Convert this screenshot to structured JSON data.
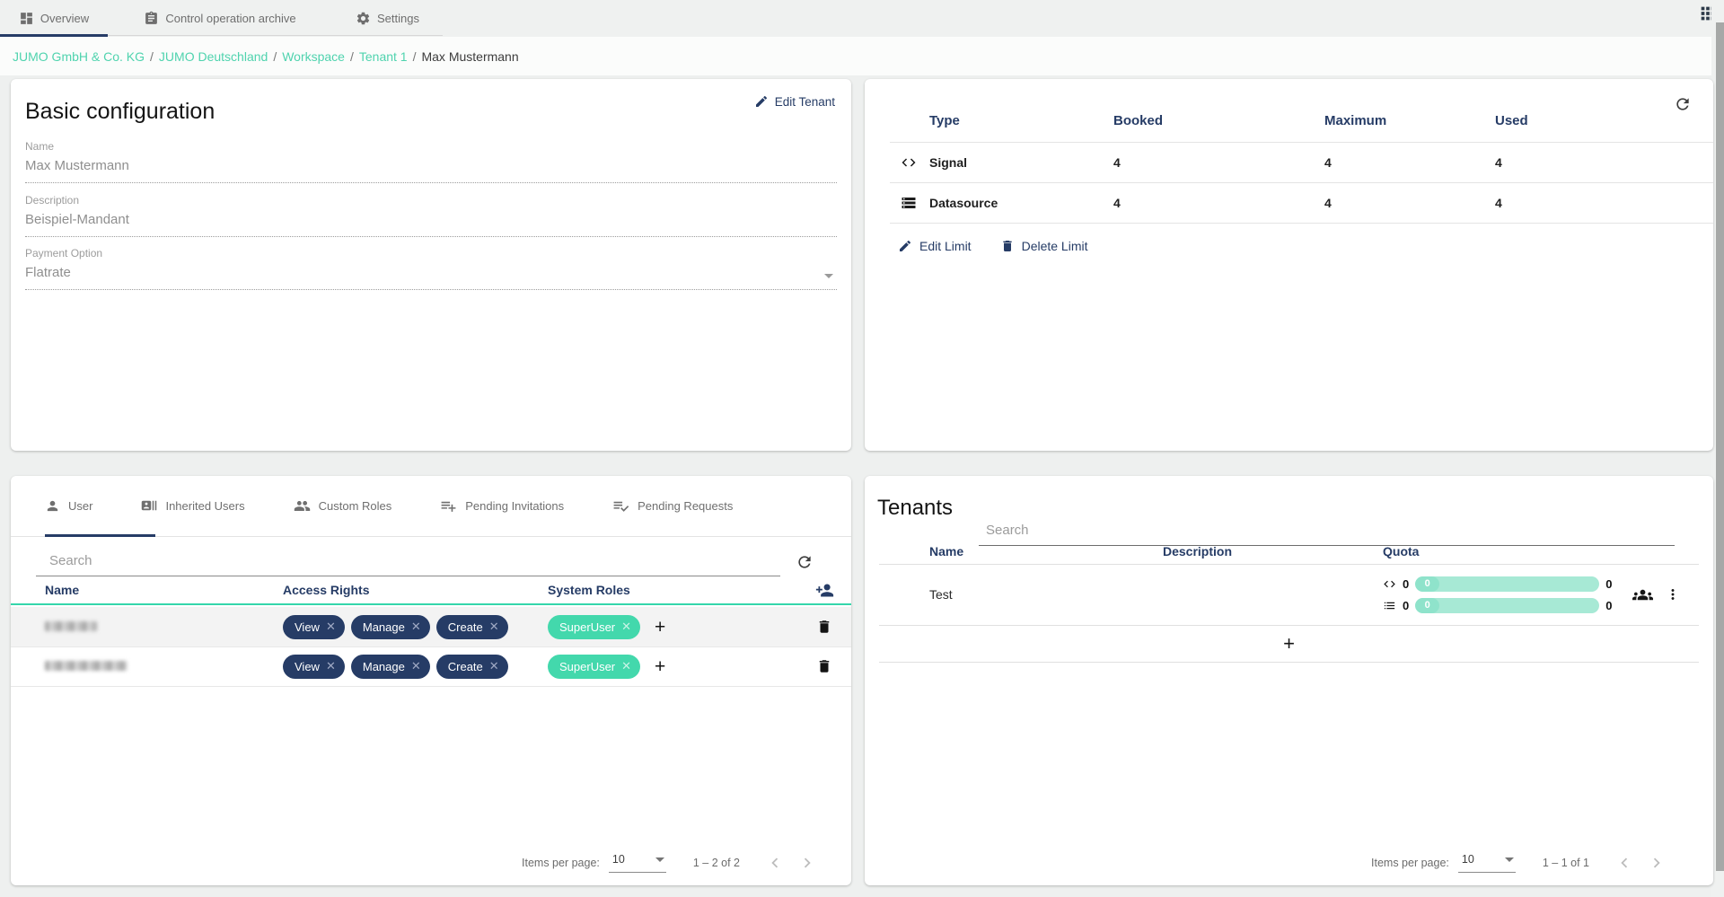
{
  "colors": {
    "navy": "#263c66",
    "teal_link": "#4fd3ae",
    "teal_chip": "#43d8ac",
    "teal_header_line": "#35d6ab",
    "quota_bar": "#a7e9d5",
    "page_bg": "#eef0ef"
  },
  "top_tabs": [
    {
      "label": "Overview",
      "icon": "dashboard-icon",
      "active": true
    },
    {
      "label": "Control operation archive",
      "icon": "clipboard-icon",
      "active": false
    },
    {
      "label": "Settings",
      "icon": "gear-icon",
      "active": false
    }
  ],
  "breadcrumb": {
    "separator": "/",
    "links": [
      "JUMO GmbH & Co. KG",
      "JUMO Deutschland",
      "Workspace",
      "Tenant 1"
    ],
    "current": "Max Mustermann"
  },
  "basic_config": {
    "title": "Basic configuration",
    "edit_button": "Edit Tenant",
    "fields": [
      {
        "label": "Name",
        "value": "Max Mustermann"
      },
      {
        "label": "Description",
        "value": "Beispiel-Mandant"
      },
      {
        "label": "Payment Option",
        "value": "Flatrate",
        "dropdown": true
      }
    ]
  },
  "limits": {
    "headers": [
      "Type",
      "Booked",
      "Maximum",
      "Used"
    ],
    "rows": [
      {
        "label": "Signal",
        "icon": "code-icon",
        "values": [
          "4",
          "4",
          "4"
        ]
      },
      {
        "label": "Datasource",
        "icon": "storage-icon",
        "values": [
          "4",
          "4",
          "4"
        ]
      }
    ],
    "edit_label": "Edit Limit",
    "delete_label": "Delete Limit"
  },
  "users_panel": {
    "tabs": [
      {
        "label": "User",
        "icon": "person-icon",
        "active": true
      },
      {
        "label": "Inherited Users",
        "icon": "contact-card-icon",
        "active": false
      },
      {
        "label": "Custom Roles",
        "icon": "people-icon",
        "active": false
      },
      {
        "label": "Pending Invitations",
        "icon": "playlist-add-icon",
        "active": false
      },
      {
        "label": "Pending Requests",
        "icon": "playlist-check-icon",
        "active": false
      }
    ],
    "search_placeholder": "Search",
    "headers": [
      "Name",
      "Access Rights",
      "System Roles"
    ],
    "rows": [
      {
        "name_redacted": true,
        "access": [
          "View",
          "Manage",
          "Create"
        ],
        "roles": [
          "SuperUser"
        ]
      },
      {
        "name_redacted": true,
        "access": [
          "View",
          "Manage",
          "Create"
        ],
        "roles": [
          "SuperUser"
        ]
      }
    ],
    "pagination": {
      "items_label": "Items per page:",
      "page_size": "10",
      "range": "1 – 2 of 2"
    }
  },
  "tenants_panel": {
    "title": "Tenants",
    "search_placeholder": "Search",
    "headers": [
      "Name",
      "Description",
      "Quota"
    ],
    "rows": [
      {
        "name": "Test",
        "description": "",
        "quota": [
          {
            "icon": "code-icon",
            "left": "0",
            "fill": "0",
            "right": "0"
          },
          {
            "icon": "list-icon",
            "left": "0",
            "fill": "0",
            "right": "0"
          }
        ]
      }
    ],
    "add_label": "+",
    "pagination": {
      "items_label": "Items per page:",
      "page_size": "10",
      "range": "1 – 1 of 1"
    }
  }
}
